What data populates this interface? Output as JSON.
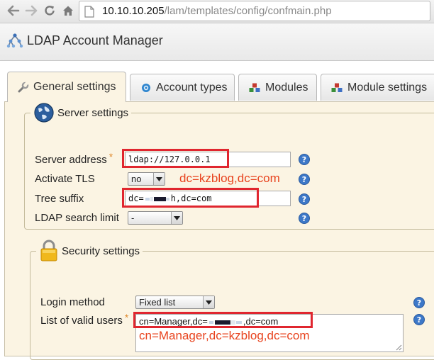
{
  "browser": {
    "url_host": "10.10.10.205",
    "url_path": "/lam/templates/config/confmain.php"
  },
  "app": {
    "title": "LDAP Account Manager"
  },
  "tabs": [
    {
      "label": "General settings",
      "active": true
    },
    {
      "label": "Account types",
      "active": false
    },
    {
      "label": "Modules",
      "active": false
    },
    {
      "label": "Module settings",
      "active": false
    }
  ],
  "server_settings": {
    "legend": "Server settings",
    "server_address_label": "Server address",
    "server_address_value": "ldap://127.0.0.1",
    "activate_tls_label": "Activate TLS",
    "activate_tls_value": "no",
    "tree_suffix_label": "Tree suffix",
    "tree_suffix_prefix": "dc=",
    "tree_suffix_suffix": "h,dc=com",
    "search_limit_label": "LDAP search limit",
    "search_limit_value": "-"
  },
  "security_settings": {
    "legend": "Security settings",
    "login_method_label": "Login method",
    "login_method_value": "Fixed list",
    "valid_users_label": "List of valid users",
    "valid_users_prefix": "cn=Manager,dc=",
    "valid_users_suffix": ",dc=com"
  },
  "annotations": {
    "tree_suffix_note": "dc=kzblog,dc=com",
    "valid_users_note": "cn=Manager,dc=kzblog,dc=com"
  },
  "colors": {
    "panel_bg": "#fbf4e3",
    "highlight": "#e0262f",
    "annotation": "#e8431e",
    "required_star": "#e08a2f",
    "help_icon": "#3d78c8"
  }
}
